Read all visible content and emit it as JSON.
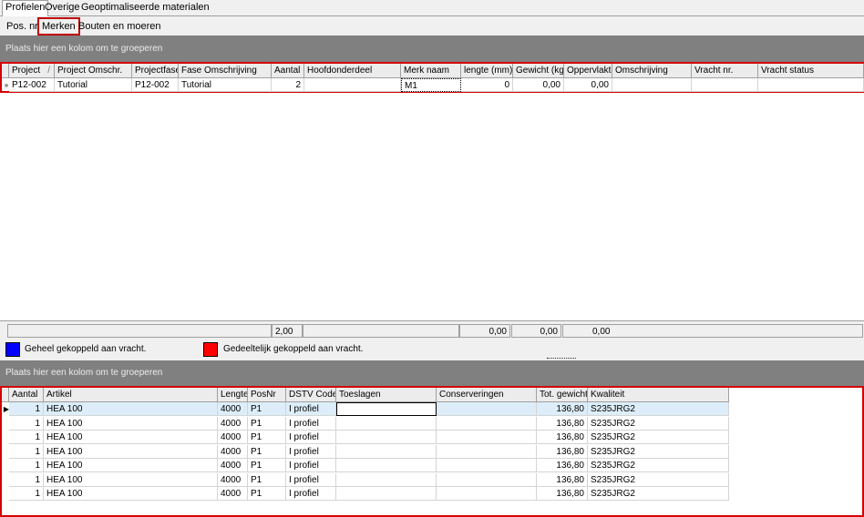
{
  "tabs": [
    "Profielen",
    "Overige",
    "Geoptimaliseerde materialen"
  ],
  "subtabs": [
    "Pos. nr.",
    "Merken",
    "Bouten en moeren"
  ],
  "group_hint": "Plaats hier een kolom om te groeperen",
  "top_grid": {
    "headers": [
      "Project",
      "Project Omschr.",
      "Projectfase",
      "Fase Omschrijving",
      "Aantal",
      "Hoofdonderdeel",
      "Merk naam",
      "lengte (mm)",
      "Gewicht (kg)",
      "Oppervlakte",
      "Omschrijving",
      "Vracht nr.",
      "Vracht status"
    ],
    "sort_indicator": "/",
    "row": [
      "P12-002",
      "Tutorial",
      "P12-002",
      "Tutorial",
      "2",
      "",
      "M1",
      "0",
      "0,00",
      "0,00",
      "",
      "",
      ""
    ]
  },
  "summary": {
    "aantal": "2,00",
    "lengte": "0,00",
    "gewicht": "0,00",
    "oppervlakte": "0,00"
  },
  "legend": [
    {
      "label": "Geheel gekoppeld aan vracht.",
      "color": "#0000ff"
    },
    {
      "label": "Gedeeltelijk gekoppeld aan vracht.",
      "color": "#ff0000"
    }
  ],
  "bottom_grid": {
    "headers": [
      "Aantal",
      "Artikel",
      "Lengte",
      "PosNr",
      "DSTV Code",
      "Toeslagen",
      "Conserveringen",
      "Tot. gewicht",
      "Kwaliteit"
    ],
    "rows": [
      [
        "1",
        "HEA  100",
        "4000",
        "P1",
        "I profiel",
        "",
        "",
        "136,80",
        "S235JRG2"
      ],
      [
        "1",
        "HEA  100",
        "4000",
        "P1",
        "I profiel",
        "",
        "",
        "136,80",
        "S235JRG2"
      ],
      [
        "1",
        "HEA  100",
        "4000",
        "P1",
        "I profiel",
        "",
        "",
        "136,80",
        "S235JRG2"
      ],
      [
        "1",
        "HEA  100",
        "4000",
        "P1",
        "I profiel",
        "",
        "",
        "136,80",
        "S235JRG2"
      ],
      [
        "1",
        "HEA  100",
        "4000",
        "P1",
        "I profiel",
        "",
        "",
        "136,80",
        "S235JRG2"
      ],
      [
        "1",
        "HEA  100",
        "4000",
        "P1",
        "I profiel",
        "",
        "",
        "136,80",
        "S235JRG2"
      ],
      [
        "1",
        "HEA  100",
        "4000",
        "P1",
        "I profiel",
        "",
        "",
        "136,80",
        "S235JRG2"
      ]
    ]
  }
}
